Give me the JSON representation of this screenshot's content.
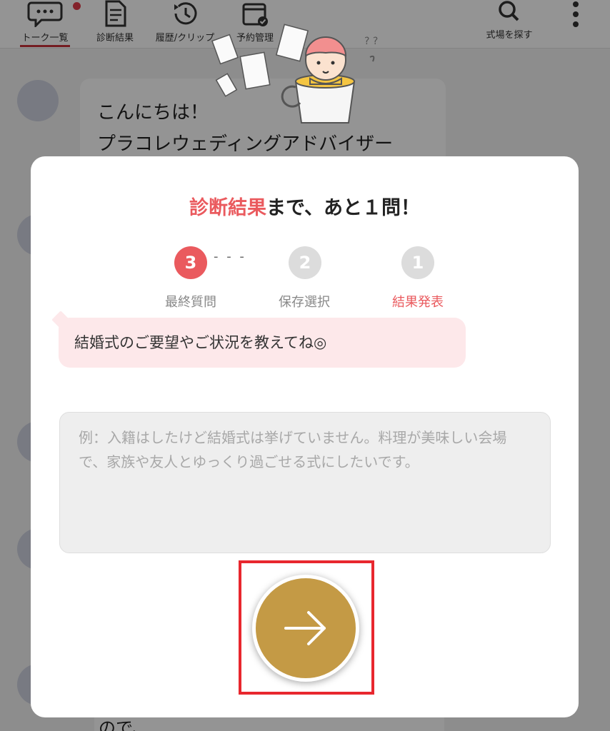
{
  "nav": {
    "items": [
      {
        "label": "トーク一覧",
        "icon": "chat-bubble-icon"
      },
      {
        "label": "診断結果",
        "icon": "document-icon"
      },
      {
        "label": "履歴/クリップ",
        "icon": "history-icon"
      },
      {
        "label": "予約管理",
        "icon": "calendar-check-icon"
      },
      {
        "label": "式場を探す",
        "icon": "search-icon"
      }
    ],
    "menu_icon": "more-vertical-icon"
  },
  "background_chat": {
    "greeting_line1": "こんにちは！",
    "greeting_line2": "プラコレウェディングアドバイザー",
    "bottom_partial": "ので、"
  },
  "modal": {
    "title_accent": "診断結果",
    "title_rest": "まで、あと１問！",
    "steps": [
      {
        "number": "3",
        "label": "最終質問",
        "state": "current"
      },
      {
        "number": "2",
        "label": "保存選択",
        "state": "upcoming"
      },
      {
        "number": "1",
        "label": "結果発表",
        "state": "goal"
      }
    ],
    "step_separator": "- - -",
    "question": "結婚式のご要望やご状況を教えてね◎",
    "answer_placeholder": "例：入籍はしたけど結婚式は挙げていません。料理が美味しい会場で、家族や友人とゆっくり過ごせる式にしたいです。",
    "answer_value": "",
    "next_icon": "arrow-right-icon"
  },
  "colors": {
    "accent_red": "#ea5a5e",
    "gold": "#c49a45",
    "bubble_pink": "#fde8ea",
    "highlight": "#e8272e",
    "inactive_step": "#dcdcdc"
  }
}
